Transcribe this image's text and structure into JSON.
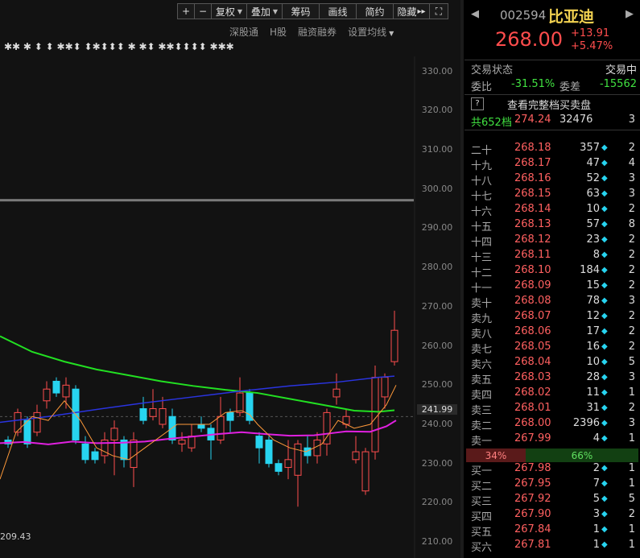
{
  "toolbar": {
    "zoom_in": "+",
    "zoom_out": "−",
    "fuquan": "复权",
    "diejia": "叠加",
    "chouma": "筹码",
    "huaxian": "画线",
    "jianyue": "简约",
    "yincang": "隐藏",
    "hide_arrow": "▸▸",
    "fullscreen": "⛶"
  },
  "subbar": [
    "深股通",
    "H股",
    "融资融券",
    "设置均线"
  ],
  "axis": {
    "y_ticks": [
      "330.00",
      "320.00",
      "310.00",
      "300.00",
      "290.00",
      "280.00",
      "270.00",
      "260.00",
      "250.00",
      "241.99",
      "240.00",
      "230.00",
      "220.00",
      "210.00"
    ],
    "min_label": "209.43"
  },
  "chart_data": {
    "type": "candlestick",
    "ylim": [
      205,
      335
    ],
    "current_price_line": 241.99,
    "candles": [
      {
        "o": 236,
        "c": 235,
        "h": 237,
        "l": 234
      },
      {
        "o": 238,
        "c": 243,
        "h": 244,
        "l": 237
      },
      {
        "o": 241,
        "c": 235,
        "h": 242,
        "l": 234
      },
      {
        "o": 238,
        "c": 243,
        "h": 245,
        "l": 237
      },
      {
        "o": 246,
        "c": 249,
        "h": 251,
        "l": 244
      },
      {
        "o": 251,
        "c": 248,
        "h": 252,
        "l": 247
      },
      {
        "o": 247,
        "c": 250,
        "h": 252,
        "l": 244
      },
      {
        "o": 249,
        "c": 236,
        "h": 250,
        "l": 235
      },
      {
        "o": 235,
        "c": 231,
        "h": 237,
        "l": 230
      },
      {
        "o": 233,
        "c": 231,
        "h": 234,
        "l": 230
      },
      {
        "o": 232,
        "c": 236,
        "h": 238,
        "l": 230
      },
      {
        "o": 236,
        "c": 239,
        "h": 241,
        "l": 227
      },
      {
        "o": 236,
        "c": 231,
        "h": 237,
        "l": 229
      },
      {
        "o": 229,
        "c": 236,
        "h": 238,
        "l": 224
      },
      {
        "o": 244,
        "c": 241,
        "h": 247,
        "l": 240
      },
      {
        "o": 242,
        "c": 244,
        "h": 249,
        "l": 241
      },
      {
        "o": 240,
        "c": 244,
        "h": 247,
        "l": 239
      },
      {
        "o": 242,
        "c": 236,
        "h": 244,
        "l": 235
      },
      {
        "o": 235,
        "c": 236,
        "h": 238,
        "l": 233
      },
      {
        "o": 234,
        "c": 237,
        "h": 240,
        "l": 233
      },
      {
        "o": 240,
        "c": 239,
        "h": 242,
        "l": 238
      },
      {
        "o": 239,
        "c": 236,
        "h": 240,
        "l": 231
      },
      {
        "o": 236,
        "c": 242,
        "h": 247,
        "l": 235
      },
      {
        "o": 243,
        "c": 241,
        "h": 244,
        "l": 238
      },
      {
        "o": 243,
        "c": 248,
        "h": 252,
        "l": 242
      },
      {
        "o": 248,
        "c": 241,
        "h": 249,
        "l": 240
      },
      {
        "o": 237,
        "c": 234,
        "h": 238,
        "l": 230
      },
      {
        "o": 236,
        "c": 230,
        "h": 237,
        "l": 229
      },
      {
        "o": 230,
        "c": 228,
        "h": 231,
        "l": 227
      },
      {
        "o": 229,
        "c": 231,
        "h": 236,
        "l": 226
      },
      {
        "o": 227,
        "c": 235,
        "h": 236,
        "l": 219
      },
      {
        "o": 234,
        "c": 232,
        "h": 237,
        "l": 230
      },
      {
        "o": 232,
        "c": 236,
        "h": 238,
        "l": 230
      },
      {
        "o": 235,
        "c": 243,
        "h": 244,
        "l": 232
      },
      {
        "o": 247,
        "c": 249,
        "h": 253,
        "l": 245
      },
      {
        "o": 240,
        "c": 242,
        "h": 244,
        "l": 239
      },
      {
        "o": 231,
        "c": 233,
        "h": 237,
        "l": 230
      },
      {
        "o": 223,
        "c": 233,
        "h": 234,
        "l": 222
      },
      {
        "o": 233,
        "c": 252,
        "h": 255,
        "l": 231
      },
      {
        "o": 247,
        "c": 252,
        "h": 253,
        "l": 244
      },
      {
        "o": 256,
        "c": 264,
        "h": 269,
        "l": 255
      }
    ],
    "ma_green": [
      [
        0,
        262.5
      ],
      [
        40,
        258.5
      ],
      [
        80,
        256
      ],
      [
        120,
        254
      ],
      [
        160,
        252.5
      ],
      [
        200,
        251
      ],
      [
        240,
        249.8
      ],
      [
        280,
        248.8
      ],
      [
        320,
        248
      ],
      [
        360,
        246.5
      ],
      [
        400,
        245
      ],
      [
        440,
        243.5
      ],
      [
        470,
        243.2
      ],
      [
        490,
        243.6
      ]
    ],
    "ma_blue": [
      [
        0,
        240.5
      ],
      [
        60,
        242
      ],
      [
        120,
        243.8
      ],
      [
        180,
        245.5
      ],
      [
        240,
        247
      ],
      [
        300,
        248.5
      ],
      [
        360,
        249.8
      ],
      [
        420,
        250.8
      ],
      [
        470,
        252
      ],
      [
        490,
        252.3
      ]
    ],
    "ma_magenta": [
      [
        0,
        235.2
      ],
      [
        30,
        235.5
      ],
      [
        60,
        234.9
      ],
      [
        90,
        235.6
      ],
      [
        120,
        235.2
      ],
      [
        150,
        235.3
      ],
      [
        180,
        235.6
      ],
      [
        210,
        236.3
      ],
      [
        240,
        236.9
      ],
      [
        270,
        237.5
      ],
      [
        300,
        238
      ],
      [
        330,
        237.5
      ],
      [
        360,
        237.1
      ],
      [
        390,
        237.2
      ],
      [
        410,
        237.7
      ],
      [
        430,
        238.2
      ],
      [
        460,
        238.1
      ],
      [
        480,
        239.5
      ],
      [
        492,
        241
      ]
    ],
    "ma_orange": [
      [
        0,
        226
      ],
      [
        20,
        238
      ],
      [
        40,
        242
      ],
      [
        60,
        241
      ],
      [
        80,
        246
      ],
      [
        100,
        241
      ],
      [
        120,
        234
      ],
      [
        140,
        232
      ],
      [
        160,
        231
      ],
      [
        180,
        234
      ],
      [
        200,
        237
      ],
      [
        220,
        240
      ],
      [
        240,
        240
      ],
      [
        260,
        240
      ],
      [
        280,
        243
      ],
      [
        300,
        243.5
      ],
      [
        310,
        242.5
      ],
      [
        320,
        240
      ],
      [
        340,
        236
      ],
      [
        360,
        234
      ],
      [
        380,
        233
      ],
      [
        400,
        235
      ],
      [
        420,
        241
      ],
      [
        440,
        239
      ],
      [
        460,
        240
      ],
      [
        480,
        245
      ],
      [
        492,
        250
      ]
    ]
  },
  "quote": {
    "code": "002594",
    "name": "比亚迪",
    "price": "268.00",
    "change": "+13.91",
    "change_pct": "+5.47%",
    "status_label": "交易状态",
    "status_value": "交易中",
    "weibi_label": "委比",
    "weibi_value": "-31.51%",
    "weicha_label": "委差",
    "weicha_value": "-15562",
    "full_book_icon": "?",
    "full_book_label": "查看完整档买卖盘",
    "total_label": "共652档",
    "total_price": "274.24",
    "total_vol": "32476",
    "total_cnt": "3",
    "ratio_sell": "34%",
    "ratio_buy": "66%"
  },
  "order_book": {
    "asks": [
      {
        "label": "二十",
        "price": "268.18",
        "vol": "357",
        "dot": true,
        "cnt": "2"
      },
      {
        "label": "十九",
        "price": "268.17",
        "vol": "47",
        "dot": true,
        "cnt": "4"
      },
      {
        "label": "十八",
        "price": "268.16",
        "vol": "52",
        "dot": true,
        "cnt": "3"
      },
      {
        "label": "十七",
        "price": "268.15",
        "vol": "63",
        "dot": true,
        "cnt": "3"
      },
      {
        "label": "十六",
        "price": "268.14",
        "vol": "10",
        "dot": true,
        "cnt": "2"
      },
      {
        "label": "十五",
        "price": "268.13",
        "vol": "57",
        "dot": true,
        "cnt": "8"
      },
      {
        "label": "十四",
        "price": "268.12",
        "vol": "23",
        "dot": true,
        "cnt": "2"
      },
      {
        "label": "十三",
        "price": "268.11",
        "vol": "8",
        "dot": true,
        "cnt": "2"
      },
      {
        "label": "十二",
        "price": "268.10",
        "vol": "184",
        "dot": true,
        "cnt": "2"
      },
      {
        "label": "十一",
        "price": "268.09",
        "vol": "15",
        "dot": true,
        "cnt": "2"
      },
      {
        "label": "卖十",
        "price": "268.08",
        "vol": "78",
        "dot": true,
        "cnt": "3"
      },
      {
        "label": "卖九",
        "price": "268.07",
        "vol": "12",
        "dot": true,
        "cnt": "2"
      },
      {
        "label": "卖八",
        "price": "268.06",
        "vol": "17",
        "dot": true,
        "cnt": "2"
      },
      {
        "label": "卖七",
        "price": "268.05",
        "vol": "16",
        "dot": true,
        "cnt": "2"
      },
      {
        "label": "卖六",
        "price": "268.04",
        "vol": "10",
        "dot": true,
        "cnt": "5"
      },
      {
        "label": "卖五",
        "price": "268.03",
        "vol": "28",
        "dot": true,
        "cnt": "3"
      },
      {
        "label": "卖四",
        "price": "268.02",
        "vol": "11",
        "dot": true,
        "cnt": "1"
      },
      {
        "label": "卖三",
        "price": "268.01",
        "vol": "31",
        "dot": true,
        "cnt": "2"
      },
      {
        "label": "卖二",
        "price": "268.00",
        "vol": "2396",
        "dot": true,
        "cnt": "3"
      },
      {
        "label": "卖一",
        "price": "267.99",
        "vol": "4",
        "dot": true,
        "cnt": "1"
      }
    ],
    "bids": [
      {
        "label": "买一",
        "price": "267.98",
        "vol": "2",
        "dot": true,
        "cnt": "1"
      },
      {
        "label": "买二",
        "price": "267.95",
        "vol": "7",
        "dot": true,
        "cnt": "1"
      },
      {
        "label": "买三",
        "price": "267.92",
        "vol": "5",
        "dot": true,
        "cnt": "5"
      },
      {
        "label": "买四",
        "price": "267.90",
        "vol": "3",
        "dot": true,
        "cnt": "2"
      },
      {
        "label": "买五",
        "price": "267.84",
        "vol": "1",
        "dot": true,
        "cnt": "1"
      },
      {
        "label": "买六",
        "price": "267.81",
        "vol": "1",
        "dot": true,
        "cnt": "1"
      }
    ]
  },
  "colors": {
    "up": "#ff4d4d",
    "down": "#27d4f0",
    "ma_green": "#22e022",
    "ma_blue": "#2a34e0",
    "ma_magenta": "#e020e0",
    "ma_orange": "#ff9a3a"
  }
}
